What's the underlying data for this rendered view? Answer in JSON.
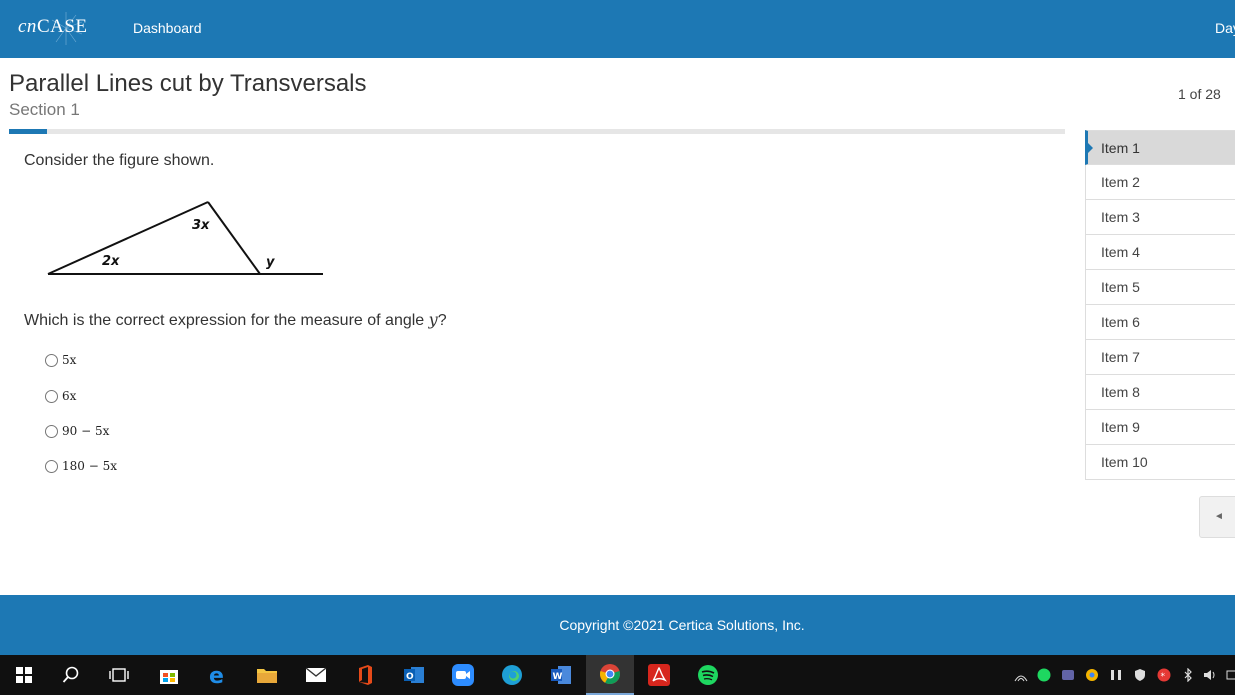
{
  "topbar": {
    "logo_prefix": "cn",
    "logo_suffix": "CASE",
    "nav_dashboard": "Dashboard",
    "user_partial": "Day"
  },
  "header": {
    "title": "Parallel Lines cut by Transversals",
    "section": "Section 1",
    "counter": "1 of 28",
    "progress": 0.036
  },
  "question": {
    "prompt": "Consider the figure shown.",
    "figure_labels": {
      "top": "3x",
      "left": "2x",
      "exterior": "y"
    },
    "text_before": "Which is the correct expression for the measure of angle ",
    "variable": "y",
    "text_after": "?",
    "choices": [
      "5x",
      "6x",
      "90 − 5x",
      "180 − 5x"
    ]
  },
  "sidebar": {
    "items": [
      "Item 1",
      "Item 2",
      "Item 3",
      "Item 4",
      "Item 5",
      "Item 6",
      "Item 7",
      "Item 8",
      "Item 9",
      "Item 10"
    ],
    "active_index": 0,
    "collapse_glyph": "◄"
  },
  "footer": {
    "copyright": "Copyright ©2021 Certica Solutions, Inc."
  },
  "taskbar": {
    "apps": [
      "windows-start",
      "search",
      "task-view",
      "store",
      "edge-legacy",
      "file-explorer",
      "mail",
      "office",
      "outlook",
      "zoom",
      "edge",
      "word",
      "chrome",
      "acrobat",
      "spotify"
    ],
    "active_app": "chrome"
  },
  "colors": {
    "brand_blue": "#1d78b4",
    "taskbar": "#101010"
  }
}
